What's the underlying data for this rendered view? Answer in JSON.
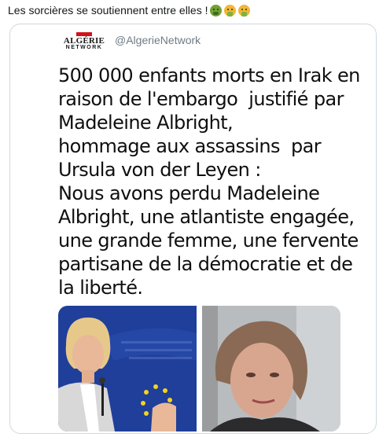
{
  "caption": {
    "text": "Les sorcières se soutiennent entre elles !",
    "emojis": [
      "sick-face-icon",
      "vomiting-face-icon",
      "vomiting-face-icon"
    ]
  },
  "card": {
    "logo": {
      "main": "ALGÉRIE",
      "sub": "NETWORK"
    },
    "handle": "@AlgerieNetwork",
    "text": "500 000 enfants morts en Irak en\nraison de l'embargo  justifié par\nMadeleine Albright,\nhommage aux assassins  par\nUrsula von der Leyen :\nNous avons perdu Madeleine\nAlbright, une atlantiste engagée,\nune grande femme, une fervente\npartisane de la démocratie et de\nla liberté.",
    "images": [
      {
        "name": "ursula-von-der-leyen-photo"
      },
      {
        "name": "madeleine-albright-photo"
      }
    ]
  },
  "colors": {
    "text": "#0f0f0f",
    "handle": "#6f7b86",
    "card_border": "#cfd9de",
    "eu_blue": "#1f3f9a",
    "eu_star": "#f5d31a"
  }
}
